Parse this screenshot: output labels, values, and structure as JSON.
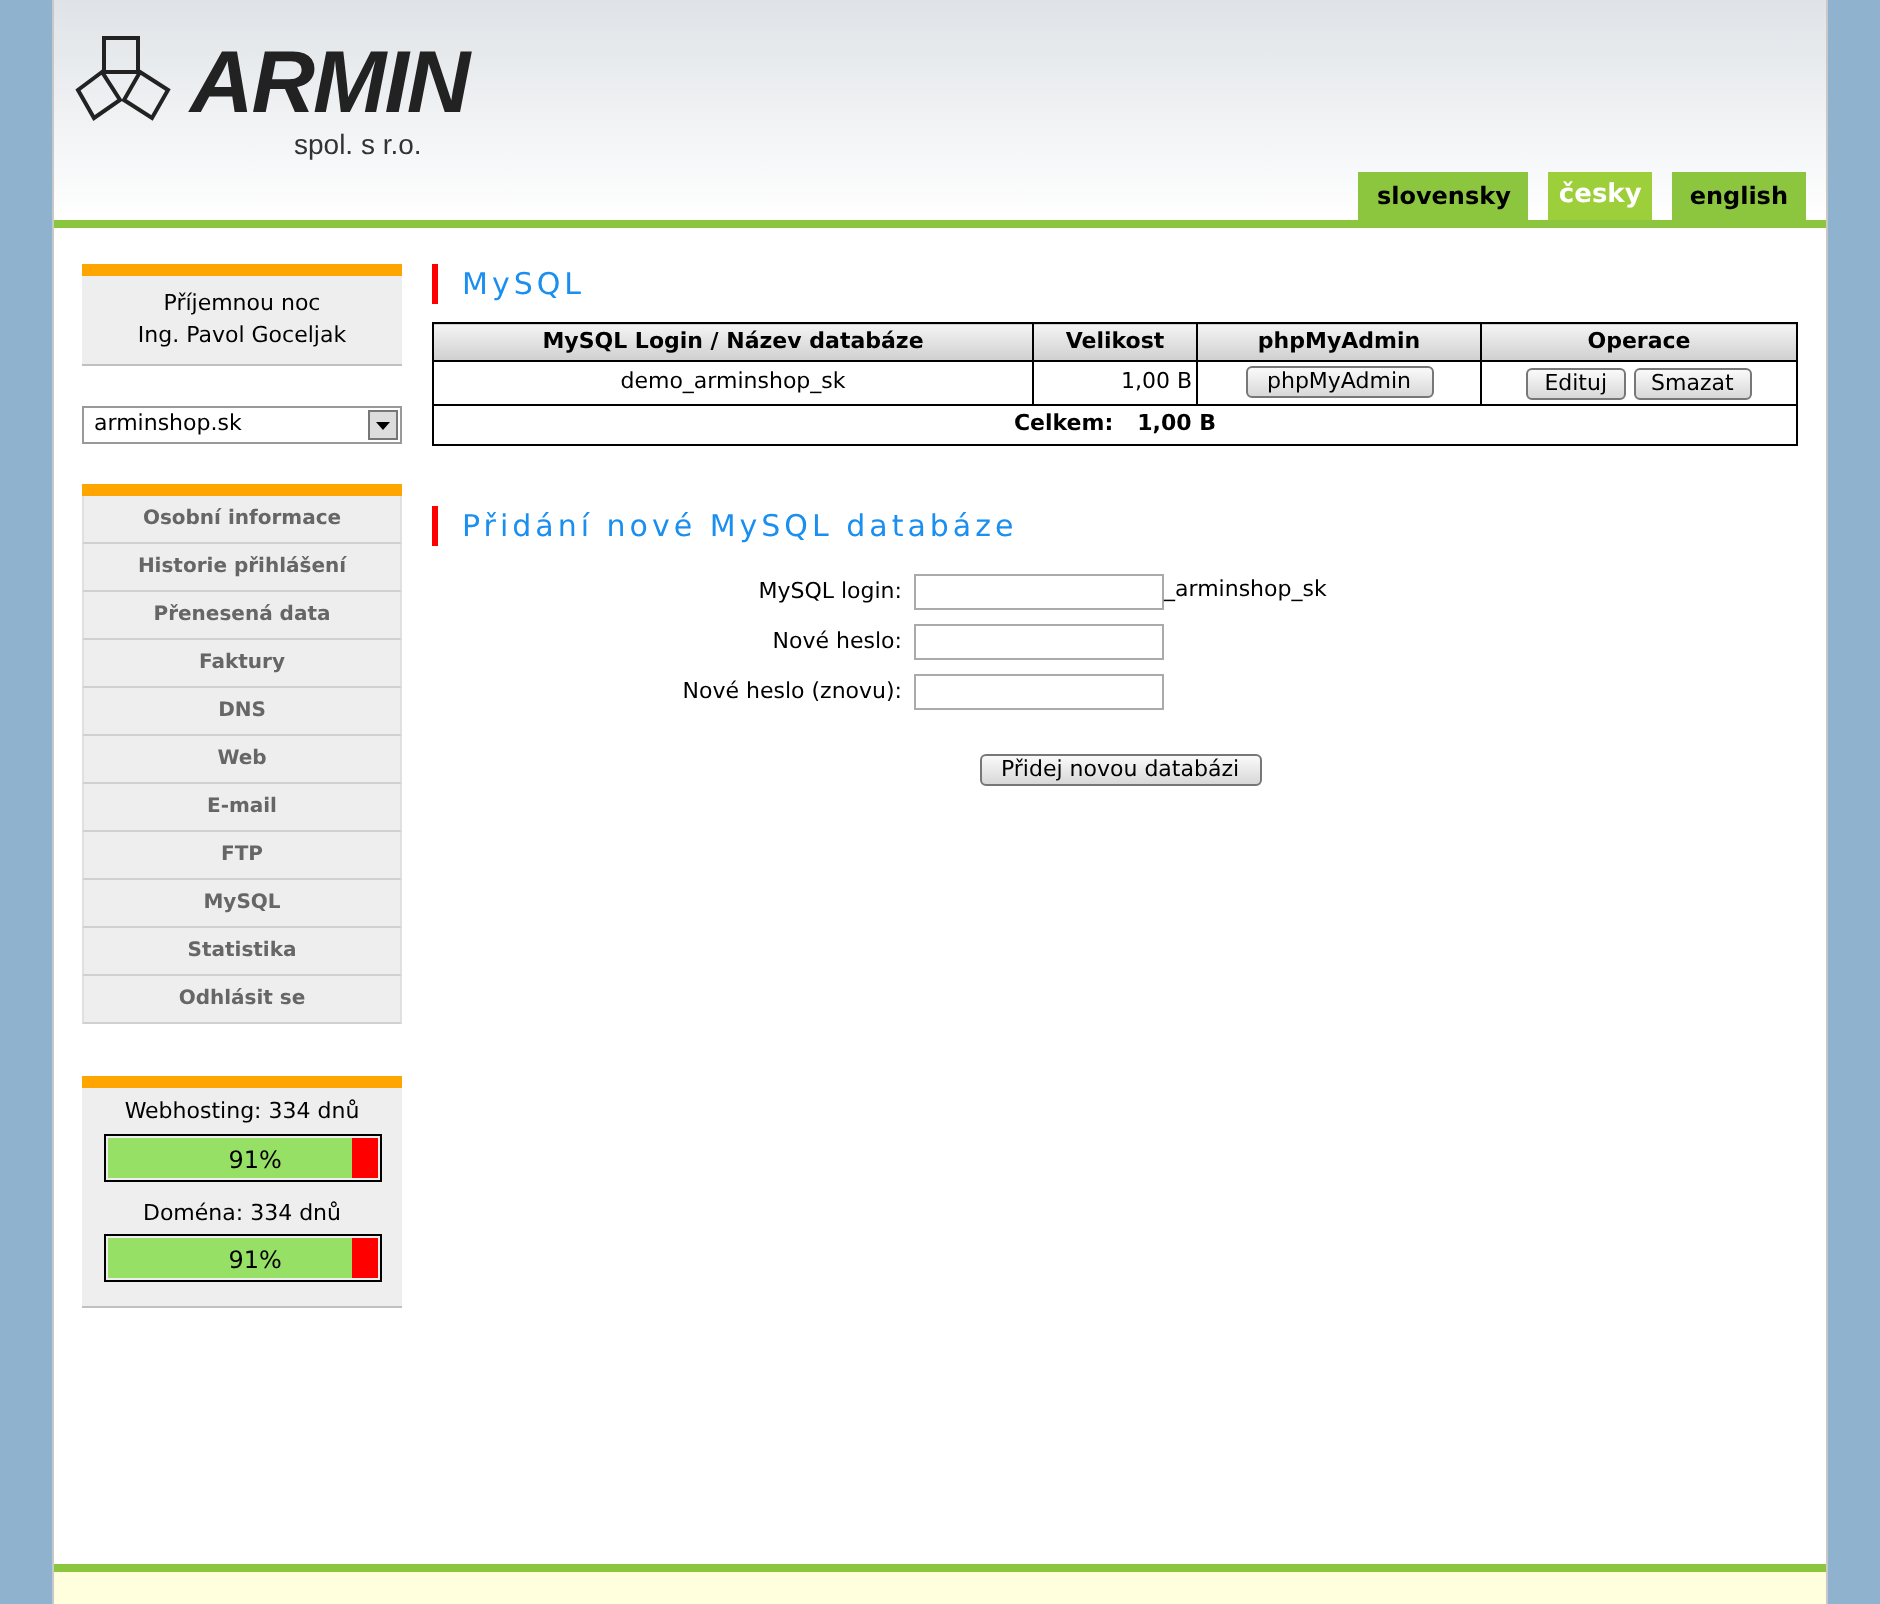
{
  "header": {
    "logo_text": "ARMIN",
    "logo_subtitle": "spol. s r.o.",
    "languages": [
      {
        "label": "slovensky",
        "selected": false
      },
      {
        "label": "česky",
        "selected": true
      },
      {
        "label": "english",
        "selected": false
      }
    ]
  },
  "sidebar": {
    "greeting": [
      "Příjemnou noc",
      "Ing. Pavol Goceljak"
    ],
    "domain_select": {
      "value": "arminshop.sk"
    },
    "menu": [
      {
        "label": "Osobní informace"
      },
      {
        "label": "Historie přihlášení"
      },
      {
        "label": "Přenesená data"
      },
      {
        "label": "Faktury"
      },
      {
        "label": "DNS"
      },
      {
        "label": "Web"
      },
      {
        "label": "E-mail"
      },
      {
        "label": "FTP"
      },
      {
        "label": "MySQL"
      },
      {
        "label": "Statistika"
      },
      {
        "label": "Odhlásit se"
      }
    ],
    "meters": [
      {
        "label": "Webhosting: 334 dnů",
        "reading": "91%",
        "level": 0.91
      },
      {
        "label": "Doména: 334 dnů",
        "reading": "91%",
        "level": 0.91
      }
    ]
  },
  "databases": {
    "title": "MySQL",
    "columns": [
      "MySQL Login / Název databáze",
      "Velikost",
      "phpMyAdmin",
      "Operace"
    ],
    "rows": [
      {
        "name": "demo_arminshop_sk",
        "size": "1,00 B",
        "phpmyadmin": "phpMyAdmin",
        "actions": [
          "Edituj",
          "Smazat"
        ]
      }
    ],
    "total_label": "Celkem:",
    "total_value": "1,00 B"
  },
  "add_form": {
    "title": "Přidání nové MySQL databáze",
    "fields": [
      {
        "label": "MySQL login:",
        "suffix": "_arminshop_sk"
      },
      {
        "label": "Nové heslo:"
      },
      {
        "label": "Nové heslo (znovu):"
      }
    ],
    "submit": "Přidej novou databázi"
  }
}
